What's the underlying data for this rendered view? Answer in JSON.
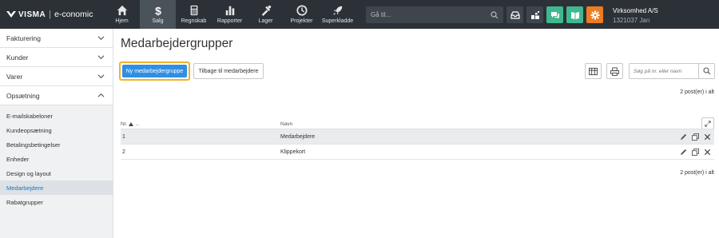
{
  "brand": {
    "name": "VISMA",
    "separator": "|",
    "app": "e-conomic"
  },
  "nav": [
    {
      "label": "Hjem",
      "icon": "home-icon"
    },
    {
      "label": "Salg",
      "icon": "dollar-icon",
      "active": true
    },
    {
      "label": "Regnskab",
      "icon": "calculator-icon"
    },
    {
      "label": "Rapporter",
      "icon": "bar-chart-icon"
    },
    {
      "label": "Lager",
      "icon": "tools-icon"
    },
    {
      "label": "Projekter",
      "icon": "clock-icon"
    },
    {
      "label": "Superkladde",
      "icon": "rocket-icon"
    }
  ],
  "search": {
    "placeholder": "Gå til..."
  },
  "toolbar_icons": [
    "inbox-icon",
    "apps-icon",
    "chat-icon",
    "book-icon",
    "gear-icon"
  ],
  "company": {
    "name": "Virksomhed A/S",
    "id_user": "1321037 Jan"
  },
  "sidebar": {
    "sections": [
      {
        "label": "Fakturering",
        "expanded": false
      },
      {
        "label": "Kunder",
        "expanded": false
      },
      {
        "label": "Varer",
        "expanded": false
      },
      {
        "label": "Opsætning",
        "expanded": true
      }
    ],
    "items": [
      {
        "label": "E-mailskabeloner"
      },
      {
        "label": "Kundeopsætning"
      },
      {
        "label": "Betalingsbetingelser"
      },
      {
        "label": "Enheder"
      },
      {
        "label": "Design og layout"
      },
      {
        "label": "Medarbejdere",
        "active": true
      },
      {
        "label": "Rabatgrupper"
      }
    ]
  },
  "main": {
    "title": "Medarbejdergrupper",
    "new_button": "Ny medarbejdergruppe",
    "back_button": "Tilbage til medarbejdere",
    "search_placeholder": "Søg på nr. eller navn",
    "count_text": "2 post(er) i alt",
    "columns": {
      "nr": "Nr.",
      "ellipsis": "...",
      "navn": "Navn"
    },
    "rows": [
      {
        "nr": "1",
        "navn": "Medarbejdere"
      },
      {
        "nr": "2",
        "navn": "Klippekort"
      }
    ]
  },
  "colors": {
    "topbar": "#2b3137",
    "accent_blue": "#2f8fe3",
    "focus_outline": "#f1b12d",
    "green": "#3fb88f",
    "orange": "#ee7c22"
  }
}
